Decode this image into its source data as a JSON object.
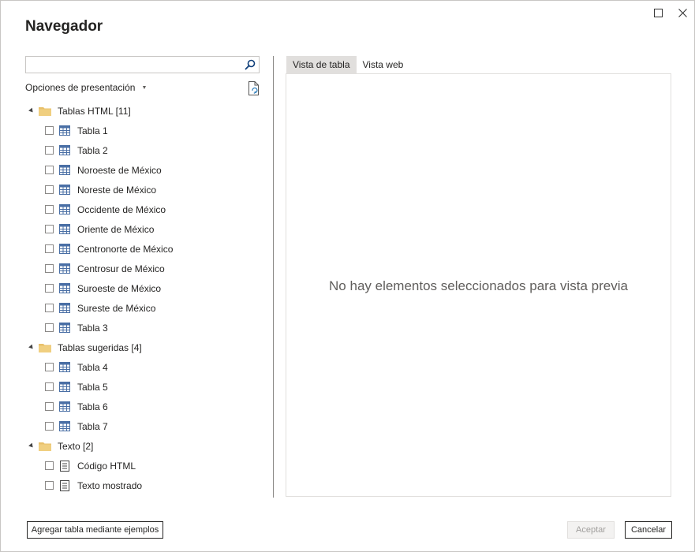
{
  "window": {
    "title": "Navegador",
    "maximize_icon": "maximize-icon",
    "close_icon": "close-icon"
  },
  "search": {
    "placeholder": "",
    "value": "",
    "icon": "search-icon"
  },
  "options": {
    "label": "Opciones de presentación",
    "icon": "chevron-down-icon",
    "refresh_icon": "refresh-document-icon"
  },
  "tree": {
    "groups": [
      {
        "label": "Tablas HTML [11]",
        "items": [
          "Tabla 1",
          "Tabla 2",
          "Noroeste de México",
          "Noreste de México",
          "Occidente de México",
          "Oriente de México",
          "Centronorte de México",
          "Centrosur de México",
          "Suroeste de México",
          "Sureste de México",
          "Tabla 3"
        ]
      },
      {
        "label": "Tablas sugeridas [4]",
        "items": [
          "Tabla 4",
          "Tabla 5",
          "Tabla 6",
          "Tabla 7"
        ]
      },
      {
        "label": "Texto [2]",
        "items": [
          "Código HTML",
          "Texto mostrado"
        ]
      }
    ]
  },
  "preview": {
    "tabs": [
      "Vista de tabla",
      "Vista web"
    ],
    "active_tab": "Vista de tabla",
    "empty_message": "No hay elementos seleccionados para vista previa"
  },
  "footer": {
    "add_table_label": "Agregar tabla mediante ejemplos",
    "accept_label": "Aceptar",
    "cancel_label": "Cancelar"
  },
  "colors": {
    "folder": "#e8c06a",
    "table_icon": "#4a6fa5",
    "text": "#252423",
    "tab_active_bg": "#e1dfdd"
  }
}
